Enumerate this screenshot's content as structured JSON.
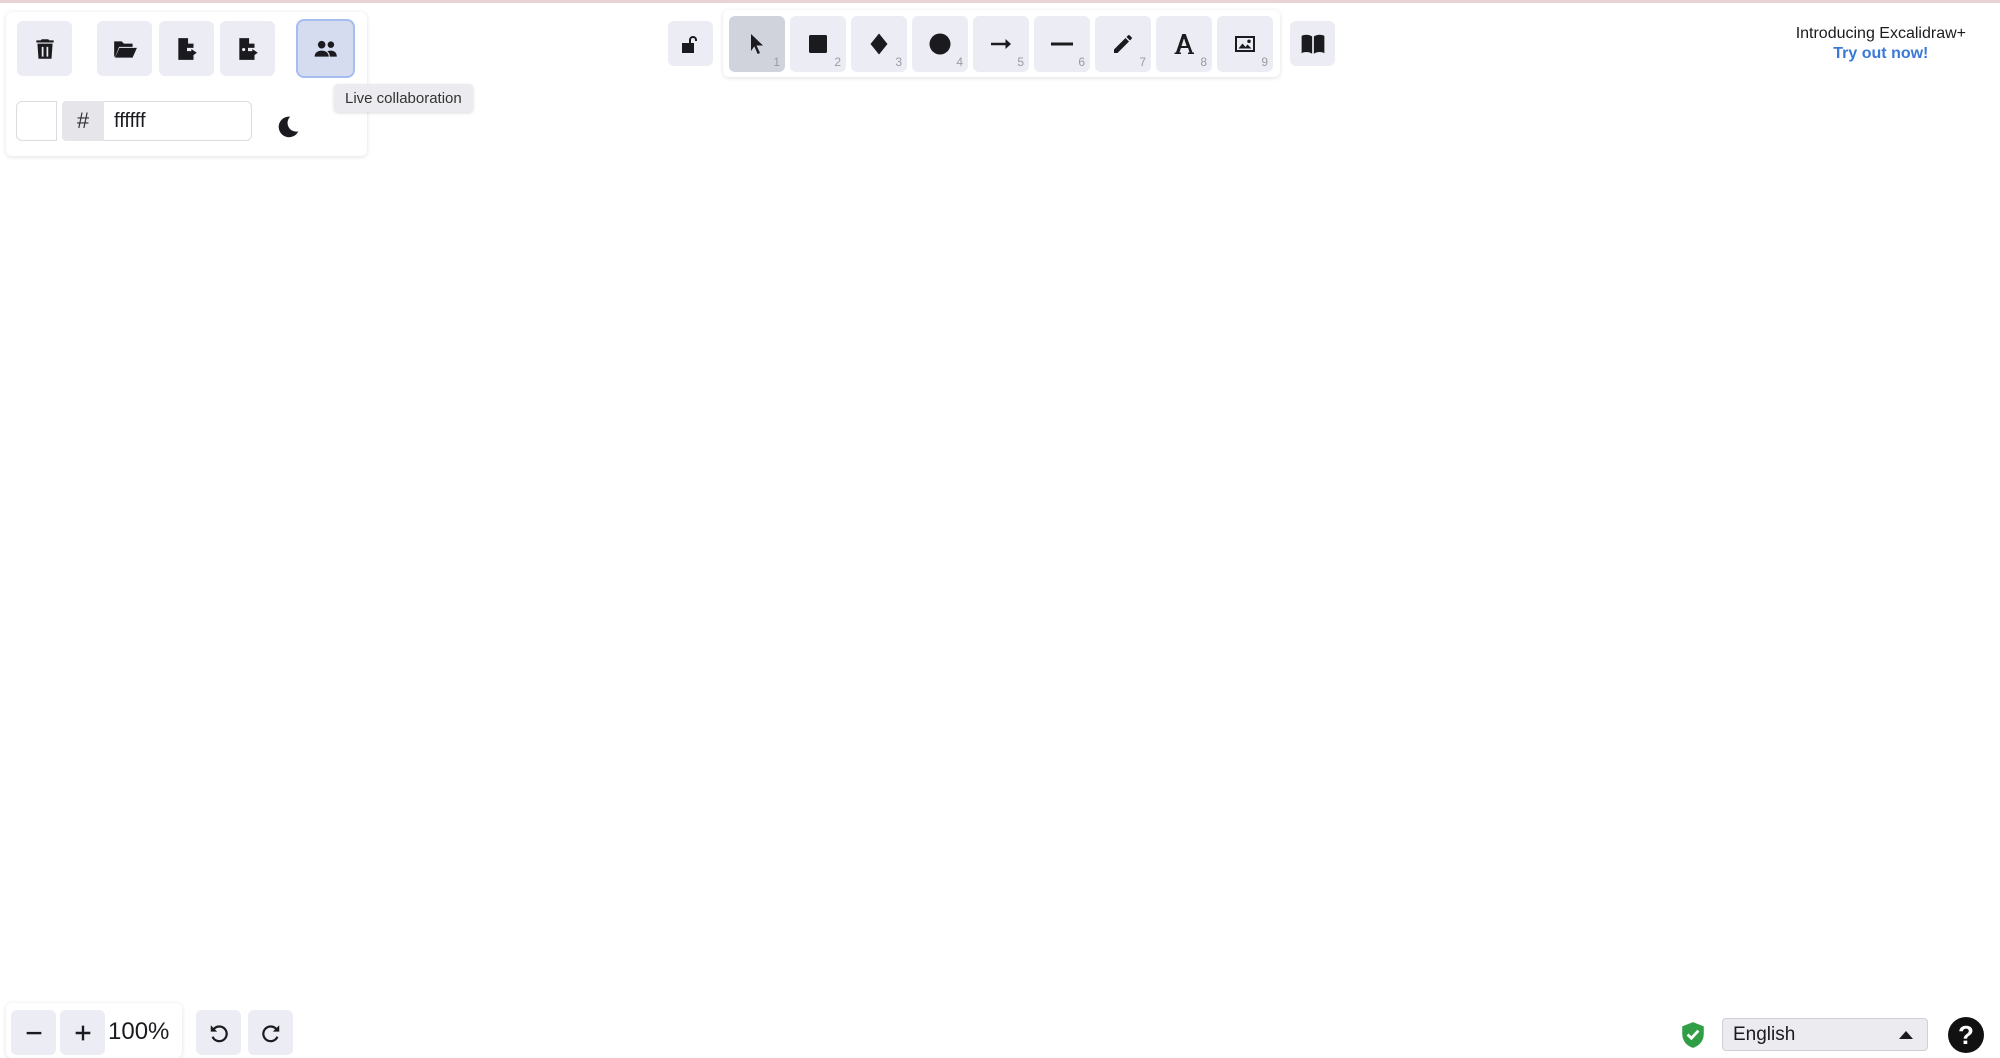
{
  "left_panel": {
    "buttons": [
      {
        "name": "clear-canvas",
        "icon": "trash-icon"
      },
      {
        "name": "open",
        "icon": "folder-open-icon"
      },
      {
        "name": "save",
        "icon": "file-export-icon"
      },
      {
        "name": "export",
        "icon": "image-export-icon"
      },
      {
        "name": "live-collaboration",
        "icon": "users-icon",
        "active": true
      }
    ],
    "background_color": {
      "hash": "#",
      "hex_value": "ffffff",
      "swatch_color": "#ffffff"
    },
    "theme_icon": "moon-icon",
    "tooltip": "Live collaboration"
  },
  "toolbar": {
    "lock_icon": "unlock-icon",
    "tools": [
      {
        "name": "selection",
        "icon": "pointer-icon",
        "key": "1",
        "selected": true
      },
      {
        "name": "rectangle",
        "icon": "square-icon",
        "key": "2"
      },
      {
        "name": "diamond",
        "icon": "diamond-icon",
        "key": "3"
      },
      {
        "name": "ellipse",
        "icon": "circle-icon",
        "key": "4"
      },
      {
        "name": "arrow",
        "icon": "arrow-icon",
        "key": "5"
      },
      {
        "name": "line",
        "icon": "line-icon",
        "key": "6"
      },
      {
        "name": "draw",
        "icon": "pencil-icon",
        "key": "7"
      },
      {
        "name": "text",
        "icon": "text-icon",
        "key": "8"
      },
      {
        "name": "image",
        "icon": "image-icon",
        "key": "9"
      }
    ],
    "library_icon": "book-icon"
  },
  "promo": {
    "title": "Introducing Excalidraw+",
    "link": "Try out now!"
  },
  "bottom": {
    "zoom_out_icon": "minus-icon",
    "zoom_in_icon": "plus-icon",
    "zoom_level": "100%",
    "undo_icon": "undo-icon",
    "redo_icon": "redo-icon",
    "shield_icon": "shield-check-icon",
    "language": "English",
    "help_label": "?"
  },
  "colors": {
    "accent": "#3b79d8",
    "button_bg": "#ececf4",
    "selected_tool_bg": "#d0d3dc",
    "shield_green": "#2f9e44"
  }
}
